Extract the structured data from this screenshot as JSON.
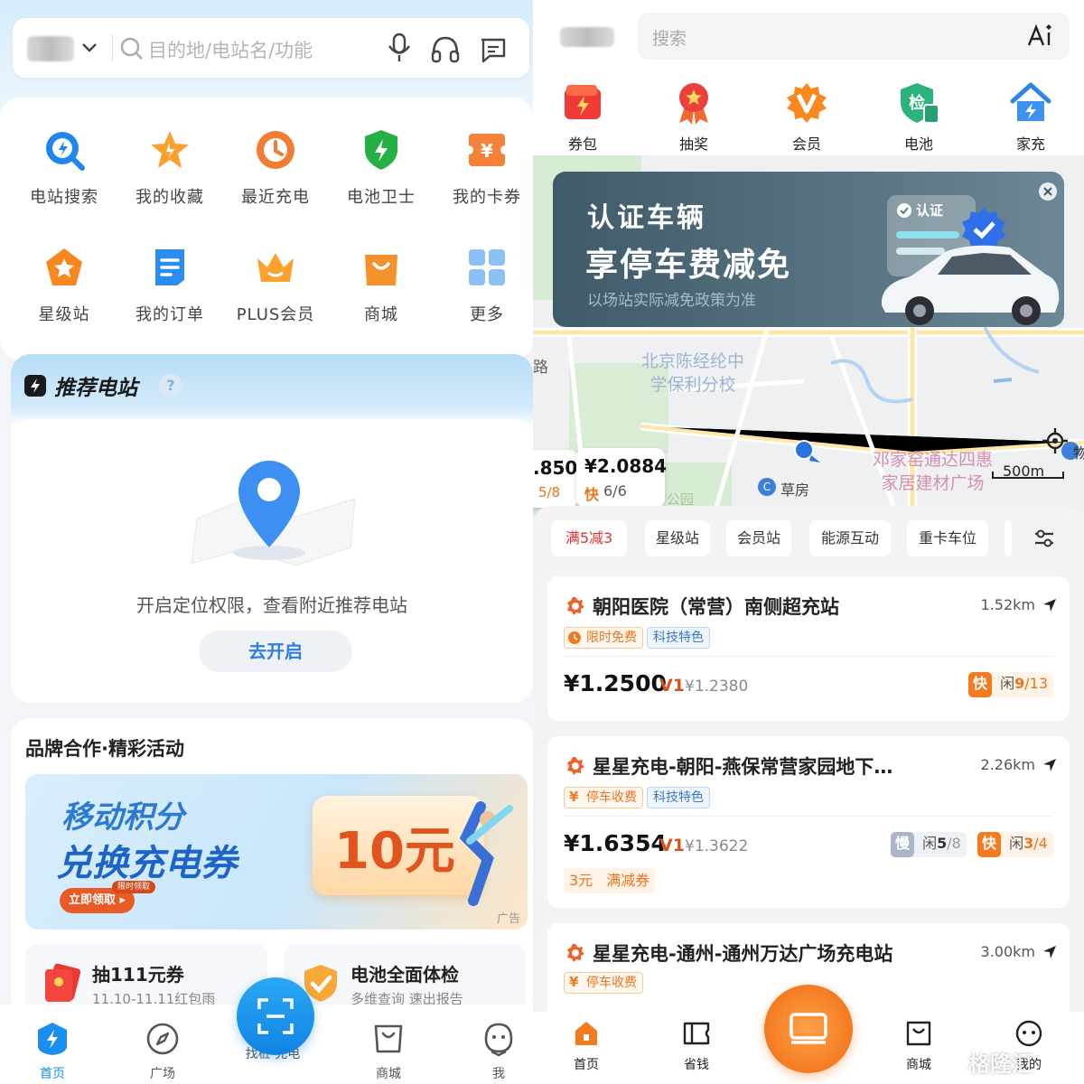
{
  "left": {
    "search": {
      "placeholder": "目的地/电站名/功能"
    },
    "quick_items": [
      {
        "label": "电站搜索",
        "icon": "station-search-icon"
      },
      {
        "label": "我的收藏",
        "icon": "star-favorite-icon"
      },
      {
        "label": "最近充电",
        "icon": "clock-icon"
      },
      {
        "label": "电池卫士",
        "icon": "battery-shield-icon"
      },
      {
        "label": "我的卡券",
        "icon": "coupon-icon"
      },
      {
        "label": "星级站",
        "icon": "star-badge-icon"
      },
      {
        "label": "我的订单",
        "icon": "order-icon"
      },
      {
        "label": "PLUS会员",
        "icon": "crown-icon"
      },
      {
        "label": "商城",
        "icon": "shop-bag-icon"
      },
      {
        "label": "更多",
        "icon": "grid-icon"
      }
    ],
    "recommend": {
      "title": "推荐电站",
      "help": "?",
      "message": "开启定位权限，查看附近推荐电站",
      "button": "去开启"
    },
    "brand": {
      "title": "品牌合作·精彩活动",
      "promo_line1": "移动积分",
      "promo_line2": "兑换充电券",
      "promo_amount": "10元",
      "promo_small": "限时领取",
      "promo_cta": "立即领取 ▸",
      "promo_ad": "广告",
      "mini1_title": "抽111元券",
      "mini1_sub": "11.10-11.11红包雨",
      "mini2_title": "电池全面体检",
      "mini2_sub": "多维查询 速出报告"
    },
    "tabbar": [
      "首页",
      "广场",
      "找桩·充电",
      "商城",
      "我"
    ]
  },
  "right": {
    "search": {
      "placeholder": "搜索"
    },
    "quick_items": [
      {
        "label": "券包",
        "icon": "voucher-icon"
      },
      {
        "label": "抽奖",
        "icon": "lottery-medal-icon"
      },
      {
        "label": "会员",
        "icon": "vip-badge-icon"
      },
      {
        "label": "电池",
        "icon": "battery-check-icon"
      },
      {
        "label": "家充",
        "icon": "home-charge-icon"
      }
    ],
    "banner": {
      "line1": "认证车辆",
      "line2": "享停车费减免",
      "line3": "以场站实际减免政策为准",
      "badge": "认证"
    },
    "map": {
      "school1": "北京陈经纶中",
      "school2": "学保利分校",
      "road": "路",
      "mall1": "邓家窑通达四惠",
      "mall2": "家居建材广场",
      "bus": "草房",
      "scale": "500m",
      "edge_label": "物",
      "mk1_price": ".850",
      "mk1_count": "5/8",
      "mk2_price": "¥2.0884",
      "mk2_fast": "快",
      "mk2_count": "6/6",
      "park": "公园"
    },
    "filters": [
      "满5减3",
      "星级站",
      "会员站",
      "能源互动",
      "重卡车位"
    ],
    "stations": [
      {
        "name": "朝阳医院（常营）南侧超充站",
        "distance": "1.52km",
        "tags": [
          "限时免费",
          "科技特色"
        ],
        "price": "¥1.2500",
        "vip": "V1",
        "vip_price": "¥1.2380",
        "fast_label": "快",
        "fast_text": "闲",
        "fast_free": "9",
        "fast_total": "/13"
      },
      {
        "name": "星星充电-朝阳-燕保常营家园地下…",
        "distance": "2.26km",
        "tags": [
          "停车收费",
          "科技特色"
        ],
        "price": "¥1.6354",
        "vip": "V1",
        "vip_price": "¥1.3622",
        "slow_label": "慢",
        "slow_text": "闲",
        "slow_free": "5",
        "slow_total": "/8",
        "fast_label": "快",
        "fast_text": "闲",
        "fast_free": "3",
        "fast_total": "/4",
        "coupon_amount": "3元",
        "coupon_text": "满减券"
      },
      {
        "name": "星星充电-通州-通州万达广场充电站",
        "distance": "3.00km",
        "tags": [
          "停车收费"
        ]
      }
    ],
    "tabbar": [
      "首页",
      "省钱",
      "商城",
      "我的"
    ],
    "watermark": "格隆汇"
  },
  "colors": {
    "accent_blue": "#1a8ff0",
    "accent_orange": "#f47a1f",
    "filter_red": "#e8322f"
  }
}
